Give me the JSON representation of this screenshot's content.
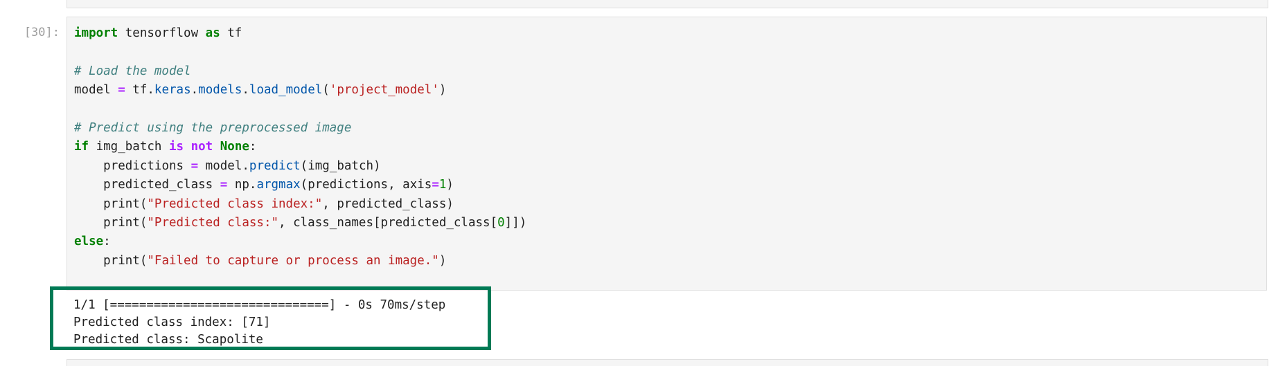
{
  "cell": {
    "prompt": "[30]:",
    "code": {
      "line1": {
        "kw_import": "import",
        "module": " tensorflow ",
        "kw_as": "as",
        "alias": " tf"
      },
      "line3": {
        "comment": "# Load the model"
      },
      "line4": {
        "var": "model ",
        "op_eq": "=",
        "obj": " tf.",
        "attr_keras": "keras",
        "dot1": ".",
        "attr_models": "models",
        "dot2": ".",
        "attr_load": "load_model",
        "paren_open": "(",
        "str": "'project_model'",
        "paren_close": ")"
      },
      "line6": {
        "comment": "# Predict using the preprocessed image"
      },
      "line7": {
        "kw_if": "if",
        "var": " img_batch ",
        "kw_is": "is",
        "space": " ",
        "kw_not": "not",
        "space2": " ",
        "kw_none": "None",
        "colon": ":"
      },
      "line8": {
        "indent": "    ",
        "var": "predictions ",
        "op_eq": "=",
        "obj": " model.",
        "fn": "predict",
        "args": "(img_batch)"
      },
      "line9": {
        "indent": "    ",
        "var": "predicted_class ",
        "op_eq": "=",
        "obj": " np.",
        "fn": "argmax",
        "args_open": "(predictions, axis",
        "op_eq2": "=",
        "num": "1",
        "args_close": ")"
      },
      "line10": {
        "indent": "    ",
        "fn": "print(",
        "str": "\"Predicted class index:\"",
        "rest": ", predicted_class)"
      },
      "line11": {
        "indent": "    ",
        "fn": "print(",
        "str": "\"Predicted class:\"",
        "rest_a": ", class_names[predicted_class[",
        "num": "0",
        "rest_b": "]])"
      },
      "line12": {
        "kw_else": "else",
        "colon": ":"
      },
      "line13": {
        "indent": "    ",
        "fn": "print(",
        "str": "\"Failed to capture or process an image.\"",
        "rest": ")"
      }
    },
    "output": {
      "progress": "1/1 [==============================] - 0s 70ms/step",
      "index_line": "Predicted class index: [71]",
      "class_line": "Predicted class: Scapolite"
    }
  },
  "colors": {
    "keyword": "#008000",
    "comment": "#408080",
    "string": "#ba2121",
    "operator": "#aa22ff",
    "highlight_border": "#007a55",
    "cell_background": "#f5f5f5"
  }
}
